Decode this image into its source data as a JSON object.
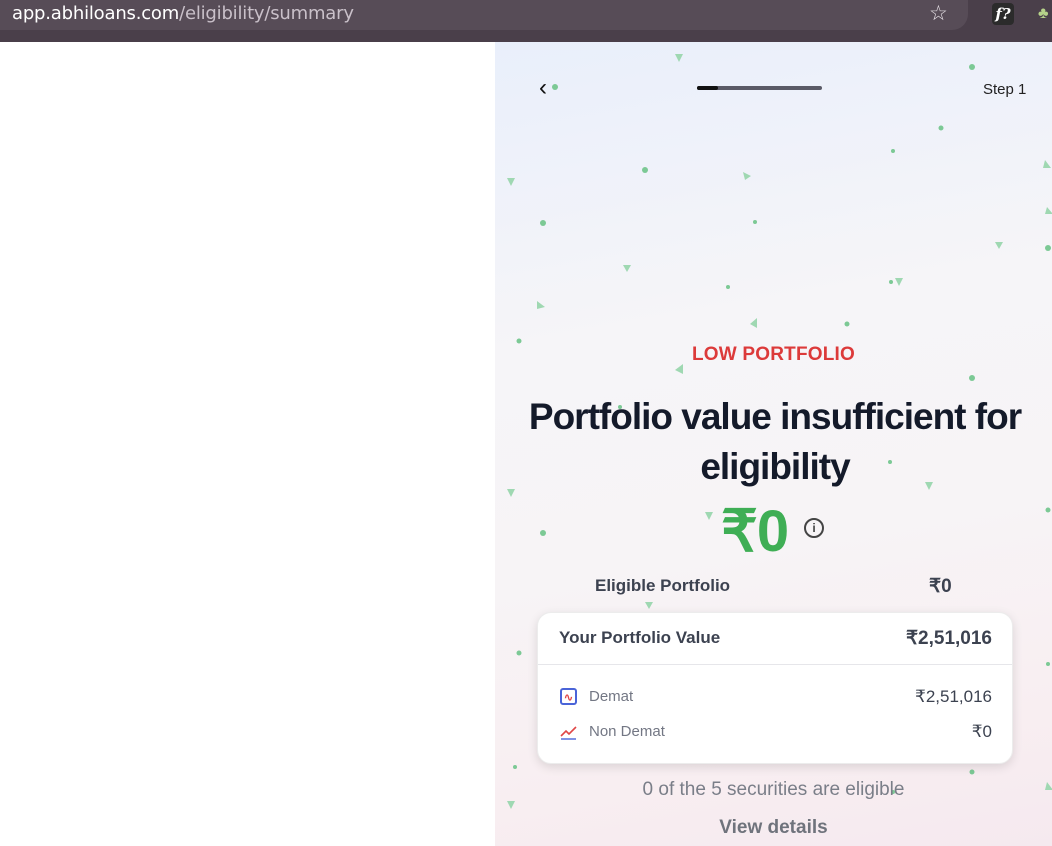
{
  "browser": {
    "url_host": "app.abhiloans.com",
    "url_path": "/eligibility/summary",
    "star_icon": "star-icon",
    "extension_label": "f?"
  },
  "header": {
    "back_icon": "chevron-left-icon",
    "progress_fraction": 0.17,
    "step_label": "Step 1"
  },
  "status": {
    "tag": "LOW PORTFOLIO",
    "headline": "Portfolio value insufficient for eligibility",
    "amount": "₹0",
    "info_icon": "info-icon",
    "tag_color": "#dc3a3a",
    "amount_color": "#3fae55"
  },
  "eligible": {
    "label": "Eligible Portfolio",
    "value": "₹0"
  },
  "portfolio_card": {
    "title": "Your Portfolio Value",
    "total": "₹2,51,016",
    "rows": [
      {
        "label": "Demat",
        "value": "₹2,51,016",
        "icon": "demat-chart-icon"
      },
      {
        "label": "Non Demat",
        "value": "₹0",
        "icon": "trend-line-icon"
      }
    ]
  },
  "footer": {
    "securities_text": "0 of the 5 securities are eligible",
    "view_details": "View details"
  }
}
